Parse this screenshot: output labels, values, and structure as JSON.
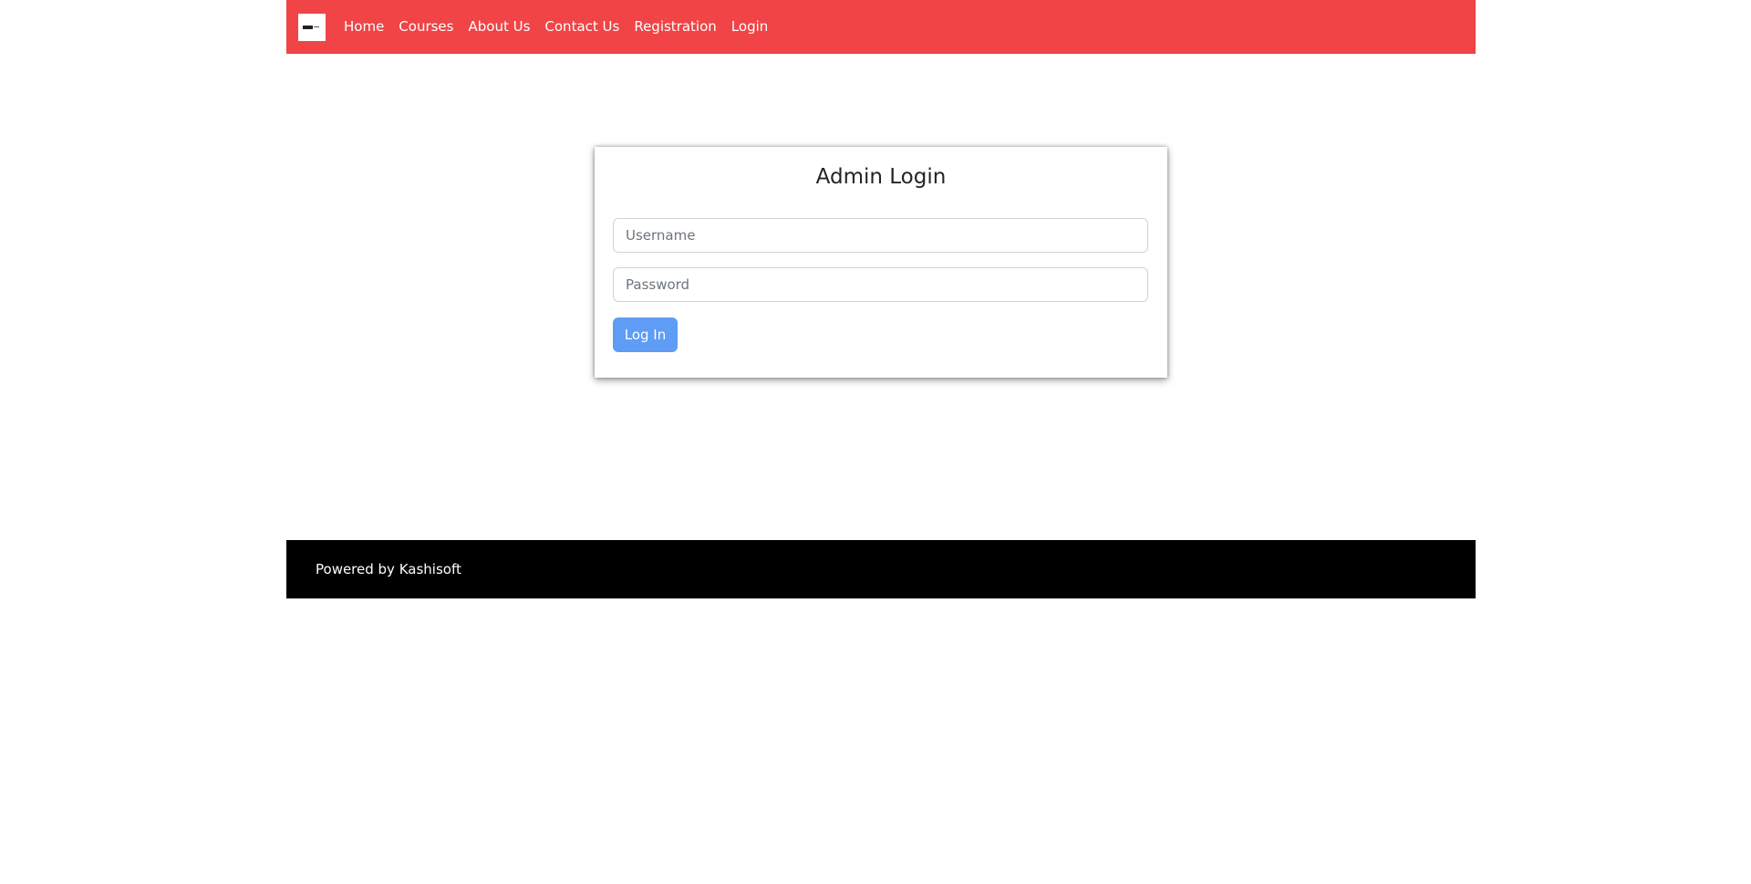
{
  "colors": {
    "navbar": "#f04446",
    "footer": "#000000",
    "primary_button": "#5e9cf5"
  },
  "brand": {
    "icon": "logo-icon"
  },
  "nav": {
    "items": [
      {
        "label": "Home"
      },
      {
        "label": "Courses"
      },
      {
        "label": "About Us"
      },
      {
        "label": "Contact Us"
      },
      {
        "label": "Registration"
      },
      {
        "label": "Login"
      }
    ]
  },
  "login": {
    "title": "Admin Login",
    "username_placeholder": "Username",
    "username_value": "",
    "password_placeholder": "Password",
    "password_value": "",
    "submit_label": "Log In"
  },
  "footer": {
    "text": "Powered by Kashisoft"
  }
}
